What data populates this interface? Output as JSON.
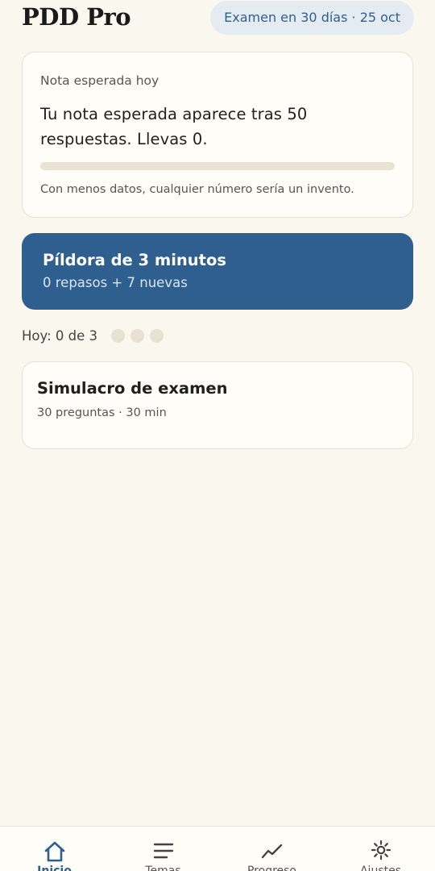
{
  "header": {
    "app_title": "PDD Pro",
    "exam_badge": "Examen en 30 días · 25 oct"
  },
  "expected_grade": {
    "label": "Nota esperada hoy",
    "message": "Tu nota esperada aparece tras 50 respuestas. Llevas 0.",
    "progress_answered": 0,
    "progress_required": 50,
    "note": "Con menos datos, cualquier número sería un invento."
  },
  "pill": {
    "title": "Píldora de 3 minutos",
    "subtitle": "0 repasos + 7 nuevas"
  },
  "today": {
    "label": "Hoy: 0 de 3",
    "done": 0,
    "total": 3
  },
  "exam_sim": {
    "title": "Simulacro de examen",
    "subtitle": "30 preguntas · 30 min"
  },
  "nav": {
    "items": [
      {
        "label": "Inicio",
        "icon": "home-icon",
        "active": true
      },
      {
        "label": "Temas",
        "icon": "list-icon",
        "active": false
      },
      {
        "label": "Progreso",
        "icon": "chart-line-icon",
        "active": false
      },
      {
        "label": "Ajustes",
        "icon": "gear-icon",
        "active": false
      }
    ]
  },
  "colors": {
    "accent": "#2e5f8f",
    "background": "#faf7ee",
    "card": "#fffdf7",
    "border": "#e6e1d2"
  }
}
